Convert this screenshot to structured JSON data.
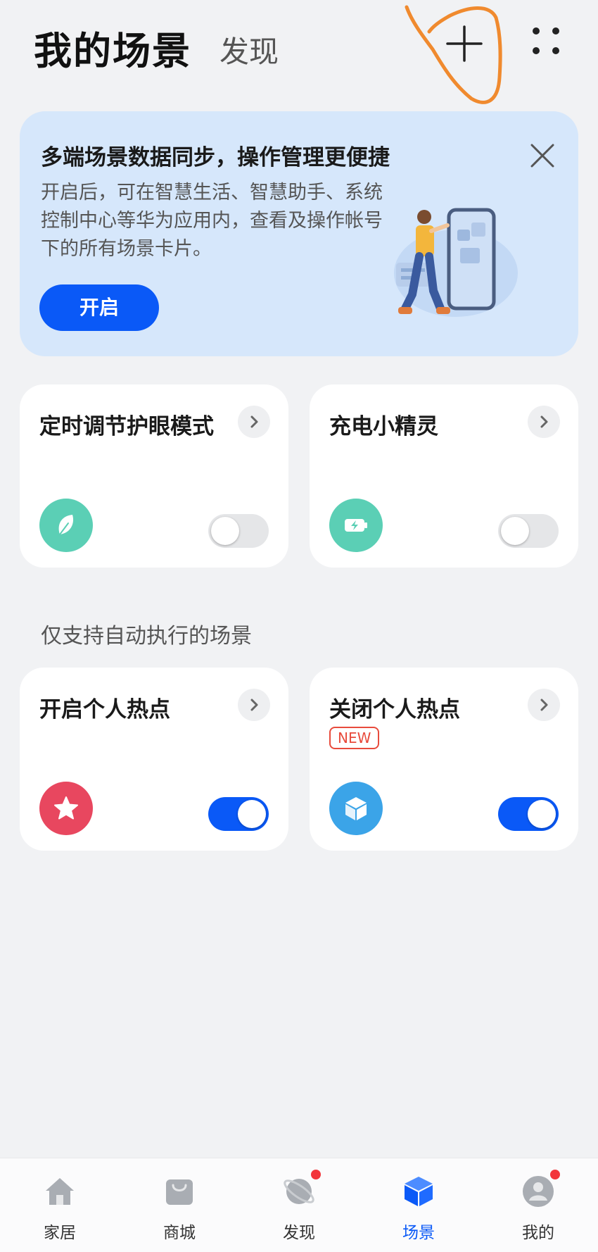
{
  "header": {
    "title": "我的场景",
    "discover_tab": "发现",
    "add_icon": "plus-icon",
    "more_icon": "more-dots-icon"
  },
  "banner": {
    "title": "多端场景数据同步，操作管理更便捷",
    "description_lines": [
      "开启后，可在智慧生活、智慧助手、系统",
      "控制中心等华为应用内，查看及操作帐号",
      "下的所有场景卡片。"
    ],
    "button_label": "开启"
  },
  "scenes": [
    {
      "title": "定时调节护眼模式",
      "icon": "leaf-icon",
      "icon_color": "#5bcfb5",
      "enabled": false
    },
    {
      "title": "充电小精灵",
      "icon": "battery-charging-icon",
      "icon_color": "#5bcfb5",
      "enabled": false
    }
  ],
  "auto_section": {
    "title": "仅支持自动执行的场景",
    "scenes": [
      {
        "title": "开启个人热点",
        "icon": "star-icon",
        "icon_color": "#e8475f",
        "enabled": true
      },
      {
        "title": "关闭个人热点",
        "badge": "NEW",
        "icon": "cube-icon",
        "icon_color": "#3ba4e8",
        "enabled": true
      }
    ]
  },
  "bottom_nav": {
    "items": [
      {
        "label": "家居",
        "icon": "home-icon",
        "active": false
      },
      {
        "label": "商城",
        "icon": "shopping-bag-icon",
        "active": false
      },
      {
        "label": "发现",
        "icon": "planet-icon",
        "active": false,
        "dot": true
      },
      {
        "label": "场景",
        "icon": "cube-icon",
        "active": true
      },
      {
        "label": "我的",
        "icon": "person-icon",
        "active": false,
        "dot": true
      }
    ]
  },
  "colors": {
    "accent": "#0a59f7",
    "background": "#f1f2f4",
    "banner_bg": "#d6e7fb",
    "annotation": "#f08a2e"
  }
}
